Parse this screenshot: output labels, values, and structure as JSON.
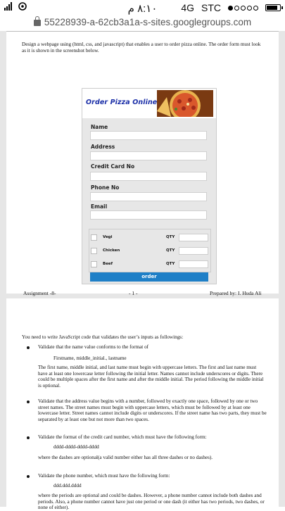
{
  "status_bar": {
    "time": "٨:١٠ م",
    "network": "4G",
    "carrier": "STC"
  },
  "url": "55228939-a-62cb3a1a-s-sites.googlegroups.com",
  "page1": {
    "intro": "Design a webpage using (html, css, and javascript) that enables a user to order pizza online. The order form must look as it is shown in the screenshot below.",
    "form": {
      "banner_title": "Order Pizza Online",
      "fields": [
        {
          "label": "Name"
        },
        {
          "label": "Address"
        },
        {
          "label": "Credit Card No"
        },
        {
          "label": "Phone No"
        },
        {
          "label": "Email"
        }
      ],
      "items": [
        {
          "name": "Vegi",
          "qty_label": "QTY"
        },
        {
          "name": "Chicken",
          "qty_label": "QTY"
        },
        {
          "name": "Beef",
          "qty_label": "QTY"
        }
      ],
      "button": "order"
    },
    "footer": {
      "left": "Assignment -8-",
      "center": "- 1 -",
      "right": "Prepared by: I. Huda Ali"
    }
  },
  "page2": {
    "intro": "You need to write JavaScript code that validates the user’s inputs as followings:",
    "b1_title": "Validate that the name value conforms to the format of",
    "b1_format": "Firstname, middle_initial., lastname",
    "b1_desc": "The first name, middle initial, and last name must begin with uppercase letters. The first and last name must have at least one lowercase letter following the initial letter. Names cannot include underscores or digits. There could be multiple spaces after the first name and after the middle initial. The period following the middle initial is optional.",
    "b2_desc": "Validate that the address value begins with a number, followed by exactly one space, followed by one or two street names. The street names must begin with uppercase letters, which must be followed by at least one lowercase letter. Street names cannot include digits or underscores. If the street name has two parts, they must be separated by at least one but not more than two spaces.",
    "b3_title": "Validate the format of the credit card number, which must have the following form:",
    "b3_format": "dddd-dddd-dddd-dddd",
    "b3_desc": "where the dashes are optional(a valid number either has all three dashes or no dashes).",
    "b4_title": "Validate the phone number, which must have the following form:",
    "b4_format": "ddd.ddd.dddd",
    "b4_desc": "where the periods are optional and could be dashes. However, a phone number cannot include both dashes and periods. Also, a phone number cannot have just one period or one dash (it either has two periods, two dashes, or none of either)."
  }
}
